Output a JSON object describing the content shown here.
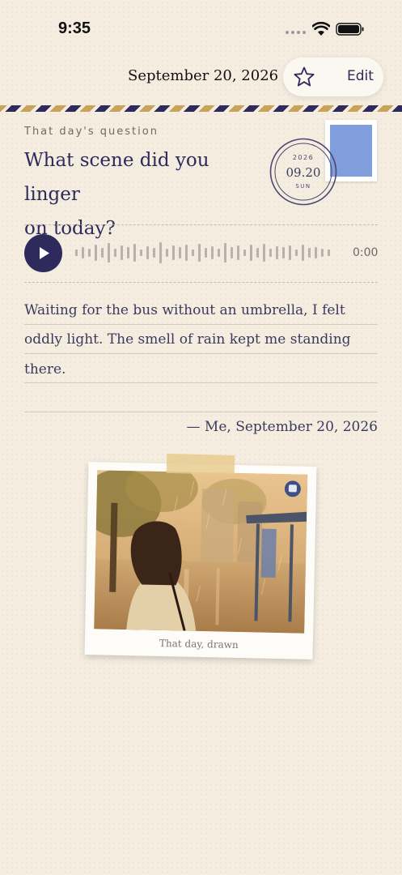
{
  "status": {
    "time": "9:35"
  },
  "header": {
    "date": "September 20, 2026",
    "edit_label": "Edit"
  },
  "question": {
    "label": "That day's question",
    "line1": "What scene did you linger",
    "line2": "on today?"
  },
  "postmark": {
    "year": "2026",
    "date": "09.20",
    "weekday": "SUN"
  },
  "audio": {
    "duration": "0:00"
  },
  "entry": {
    "line1": "Waiting for the bus without an umbrella, I felt",
    "line2": "oddly light. The smell of rain kept me standing",
    "line3": "there.",
    "signature": "— Me, September 20, 2026"
  },
  "photo": {
    "caption": "That day, drawn"
  },
  "colors": {
    "accent": "#2e2a5c",
    "stamp": "#7f9edb",
    "background": "#f5ede0",
    "tape": "#e7c98b"
  }
}
